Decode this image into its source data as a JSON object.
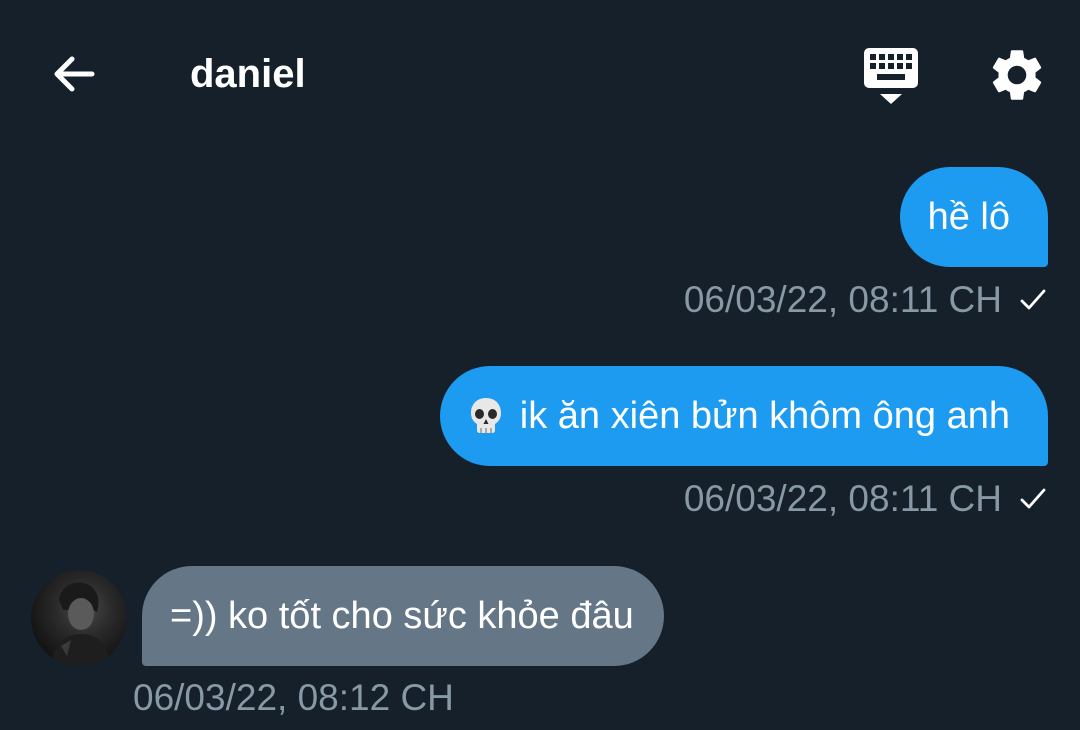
{
  "header": {
    "back_icon": "arrow-left-icon",
    "title": "daniel",
    "keyboard_icon": "keyboard-icon",
    "settings_icon": "gear-icon"
  },
  "messages": [
    {
      "direction": "sent",
      "text": "hề lô",
      "timestamp": "06/03/22, 08:11 CH",
      "status_icon": "check-icon"
    },
    {
      "direction": "sent",
      "emoji": "skull-emoji",
      "text": "ik ăn xiên bửn khôm ông anh",
      "timestamp": "06/03/22, 08:11 CH",
      "status_icon": "check-icon"
    },
    {
      "direction": "received",
      "text": "=)) ko tốt cho sức khỏe đâu",
      "timestamp": "06/03/22, 08:12 CH",
      "avatar": "avatar"
    }
  ],
  "colors": {
    "background": "#15202b",
    "sent_bubble": "#1d9bf0",
    "received_bubble": "#657786",
    "timestamp": "#8899a6",
    "text": "#ffffff"
  }
}
